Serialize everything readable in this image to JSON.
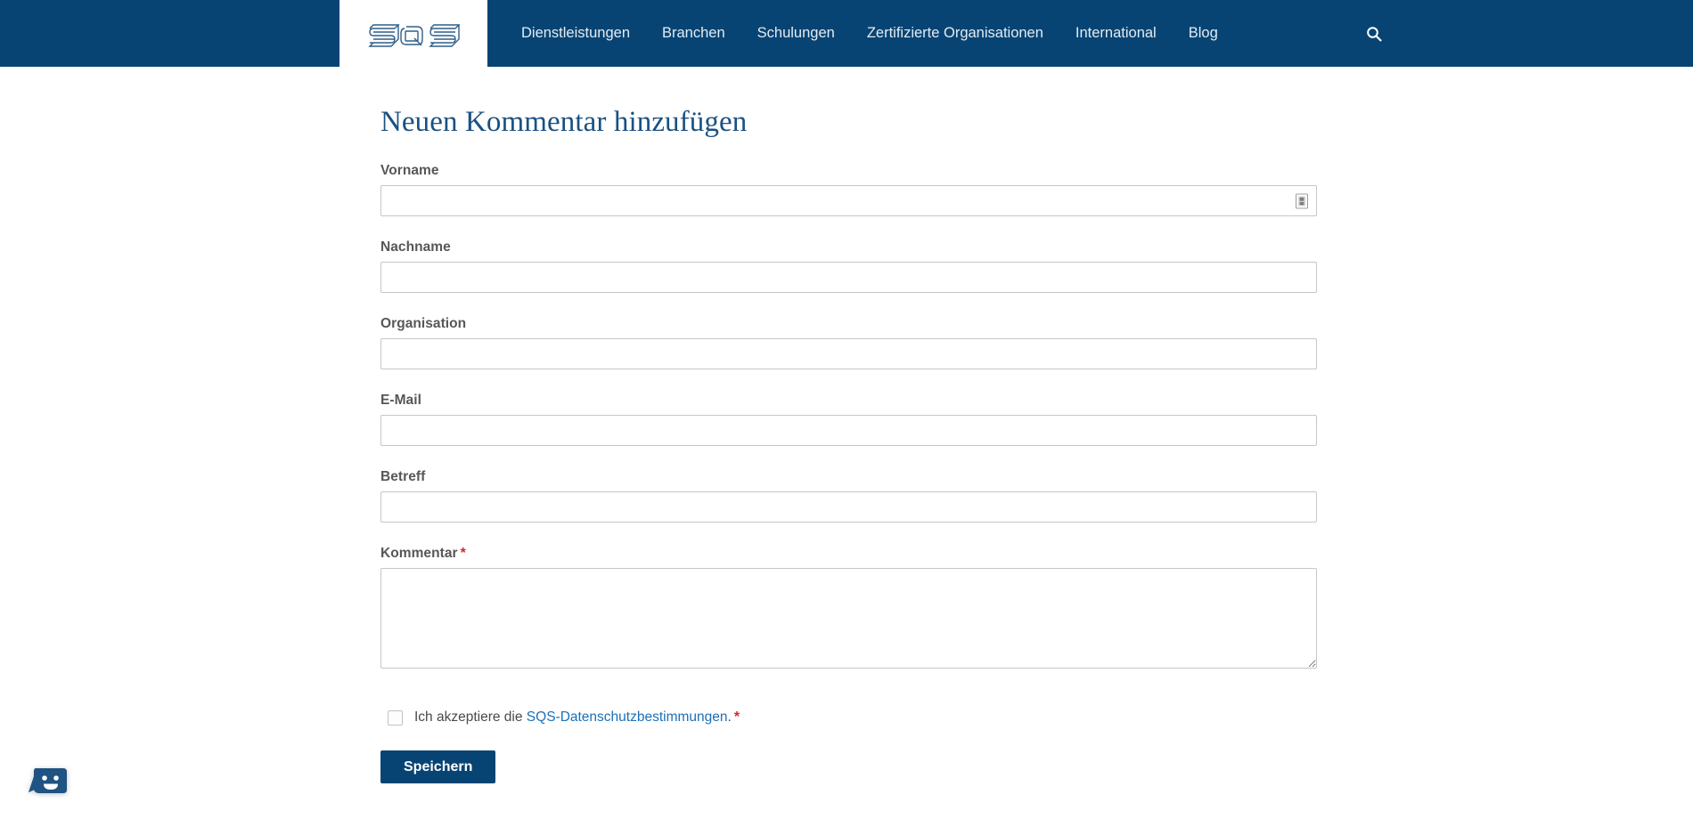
{
  "header": {
    "logo_alt": "SQS",
    "nav_items": [
      {
        "label": "Dienstleistungen"
      },
      {
        "label": "Branchen"
      },
      {
        "label": "Schulungen"
      },
      {
        "label": "Zertifizierte Organisationen"
      },
      {
        "label": "International"
      },
      {
        "label": "Blog"
      }
    ],
    "search_icon": "search-icon",
    "background_color": "#084473"
  },
  "page": {
    "title": "Neuen Kommentar hinzufügen",
    "title_color": "#1a5182"
  },
  "form": {
    "fields": [
      {
        "label": "Vorname",
        "value": "",
        "placeholder": "",
        "required": false,
        "has_autofill_icon": true
      },
      {
        "label": "Nachname",
        "value": "",
        "placeholder": "",
        "required": false,
        "has_autofill_icon": false
      },
      {
        "label": "Organisation",
        "value": "",
        "placeholder": "",
        "required": false,
        "has_autofill_icon": false
      },
      {
        "label": "E-Mail",
        "value": "",
        "placeholder": "",
        "required": false,
        "has_autofill_icon": false
      },
      {
        "label": "Betreff",
        "value": "",
        "placeholder": "",
        "required": false,
        "has_autofill_icon": false
      }
    ],
    "comment": {
      "label": "Kommentar",
      "required_marker": "*",
      "value": "",
      "placeholder": ""
    },
    "consent": {
      "text_before": "Ich akzeptiere die ",
      "link_label": "SQS-Datenschutzbestimmungen",
      "text_after": ".",
      "required_marker": "*",
      "checked": false,
      "link_color": "#1a70b8",
      "required_color": "#d4262c"
    },
    "submit_label": "Speichern",
    "required_marker": "*"
  },
  "chat_widget": {
    "icon": "chat-smiley-icon",
    "color": "#1e5382"
  }
}
